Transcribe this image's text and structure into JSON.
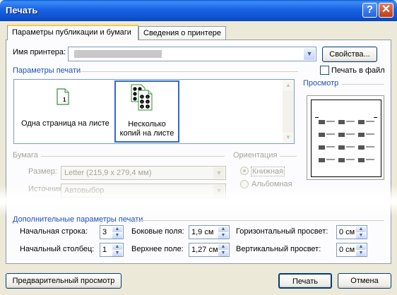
{
  "window": {
    "title": "Печать",
    "help": "?",
    "close": "✕"
  },
  "tabs": [
    {
      "label": "Параметры публикации и бумаги",
      "active": true
    },
    {
      "label": "Сведения о принтере",
      "active": false
    }
  ],
  "printer": {
    "label": "Имя принтера:",
    "value": "",
    "properties_button": "Свойства...",
    "print_to_file": "Печать в файл"
  },
  "print_options": {
    "heading": "Параметры печати",
    "layouts": [
      {
        "label": "Одна страница на листе",
        "page_number": "1",
        "selected": false
      },
      {
        "label": "Несколько копий на листе",
        "selected": true
      }
    ]
  },
  "preview": {
    "heading": "Просмотр"
  },
  "paper": {
    "heading": "Бумага",
    "size_label": "Размер:",
    "size_value": "Letter (215,9 x 279,4 мм)",
    "source_label": "Источник:",
    "source_value": "Автовыбор"
  },
  "orientation": {
    "heading": "Ориентация",
    "portrait": "Книжная",
    "landscape": "Альбомная",
    "selected": "portrait"
  },
  "extra": {
    "heading": "Дополнительные параметры печати",
    "start_row_label": "Начальная строка:",
    "start_row_value": "3",
    "start_col_label": "Начальный столбец:",
    "start_col_value": "1",
    "side_margin_label": "Боковые поля:",
    "side_margin_value": "1,9 см",
    "top_margin_label": "Верхнее поле:",
    "top_margin_value": "1,27 см",
    "h_gap_label": "Горизонтальный просвет:",
    "h_gap_value": "0 см",
    "v_gap_label": "Вертикальный просвет:",
    "v_gap_value": "0 см"
  },
  "buttons": {
    "print_preview": "Предварительный просмотр",
    "print": "Печать",
    "cancel": "Отмена"
  },
  "icons": {
    "help": "help-icon",
    "close": "close-icon",
    "dropdown": "chevron-down-icon",
    "spin": "spin-arrows-icon"
  }
}
